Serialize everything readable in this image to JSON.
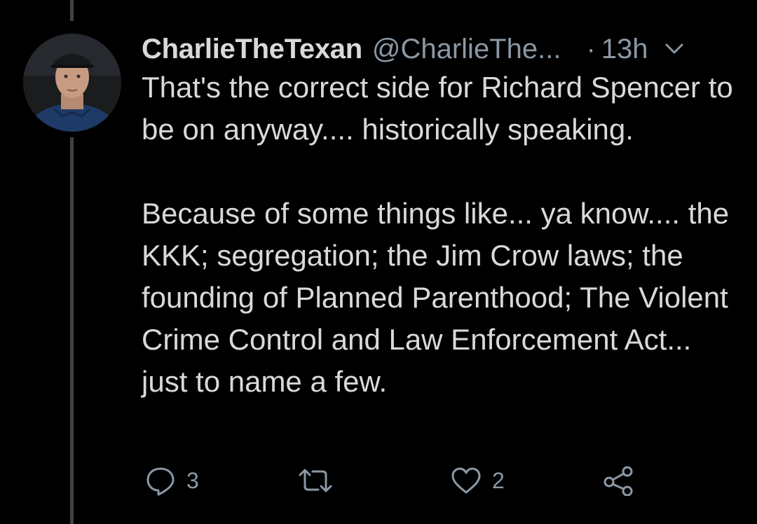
{
  "tweet": {
    "display_name": "CharlieTheTexan",
    "handle": "@CharlieThe...",
    "separator": "·",
    "timestamp": "13h",
    "text_paragraphs": [
      "That's the correct side for Richard Spencer to be on anyway.... historically speaking.",
      "Because of some things like... ya know.... the KKK; segregation; the Jim Crow laws; the founding of Planned Parenthood; The Violent Crime Control and Law Enforcement Act... just to name a few."
    ]
  },
  "actions": {
    "reply": {
      "icon": "reply-icon",
      "count": "3"
    },
    "retweet": {
      "icon": "retweet-icon",
      "count": ""
    },
    "like": {
      "icon": "heart-icon",
      "count": "2"
    },
    "share": {
      "icon": "share-icon",
      "count": ""
    }
  },
  "colors": {
    "background": "#000000",
    "primary_text": "#d9d9d9",
    "secondary_text": "#8b98a5",
    "thread_line": "#3d4247"
  }
}
